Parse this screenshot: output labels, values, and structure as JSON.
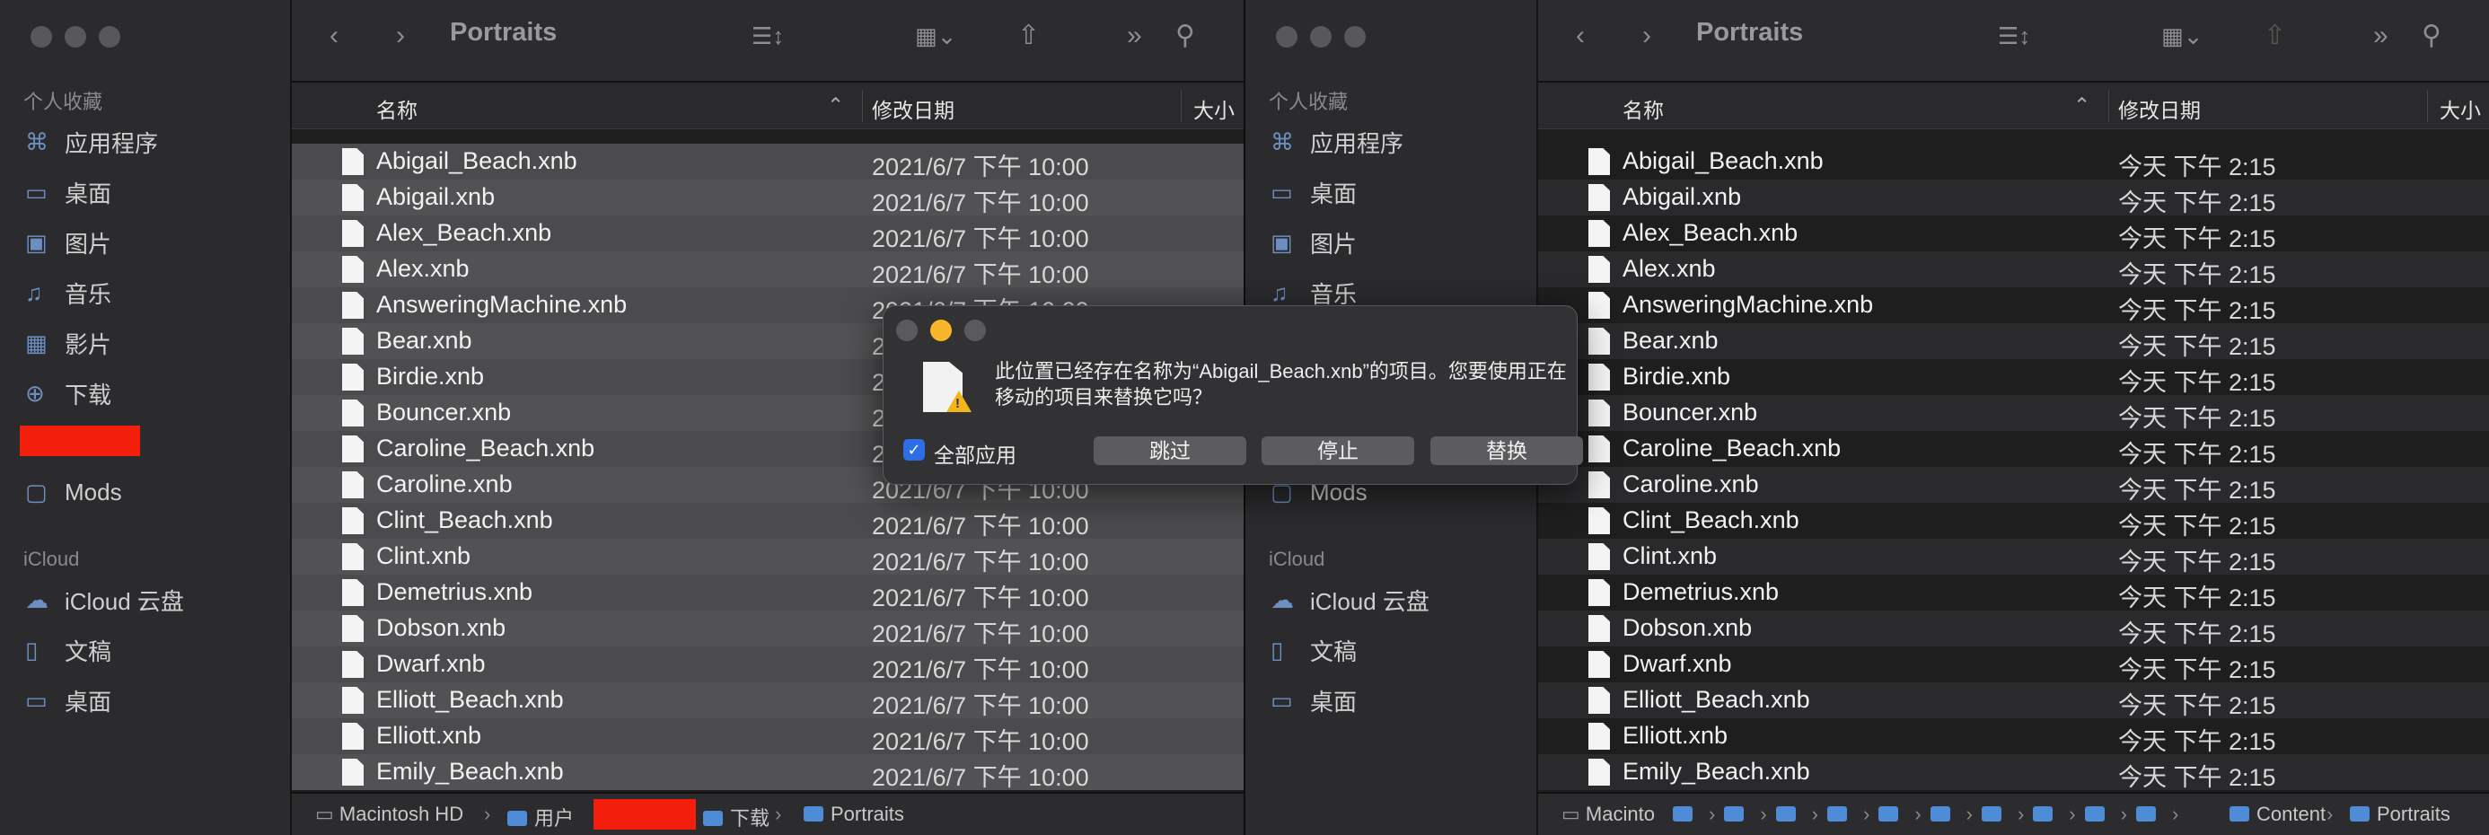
{
  "left_window": {
    "title": "Portraits",
    "sidebar": {
      "favorites_header": "个人收藏",
      "items": [
        {
          "label": "应用程序",
          "icon": "applications-icon",
          "glyph": "⌘"
        },
        {
          "label": "桌面",
          "icon": "desktop-icon",
          "glyph": "▭"
        },
        {
          "label": "图片",
          "icon": "pictures-icon",
          "glyph": "▣"
        },
        {
          "label": "音乐",
          "icon": "music-icon",
          "glyph": "♫"
        },
        {
          "label": "影片",
          "icon": "movies-icon",
          "glyph": "▦"
        },
        {
          "label": "下载",
          "icon": "downloads-icon",
          "glyph": "⊕"
        },
        {
          "label": "Mods",
          "icon": "folder-icon",
          "glyph": "▢"
        }
      ],
      "icloud_header": "iCloud",
      "icloud_items": [
        {
          "label": "iCloud 云盘",
          "icon": "icloud-drive-icon",
          "glyph": "☁"
        },
        {
          "label": "文稿",
          "icon": "documents-icon",
          "glyph": "▯"
        },
        {
          "label": "桌面",
          "icon": "desktop-icon",
          "glyph": "▭"
        }
      ]
    },
    "columns": {
      "name": "名称",
      "date": "修改日期",
      "size": "大小"
    },
    "files": [
      {
        "name": "Abigail_Beach.xnb",
        "date": "2021/6/7 下午 10:00"
      },
      {
        "name": "Abigail.xnb",
        "date": "2021/6/7 下午 10:00"
      },
      {
        "name": "Alex_Beach.xnb",
        "date": "2021/6/7 下午 10:00"
      },
      {
        "name": "Alex.xnb",
        "date": "2021/6/7 下午 10:00"
      },
      {
        "name": "AnsweringMachine.xnb",
        "date": "2021/6/7 下午 10:00"
      },
      {
        "name": "Bear.xnb",
        "date": "2021/6/7 下午 10:00"
      },
      {
        "name": "Birdie.xnb",
        "date": "2021/6/7 下午 10:00"
      },
      {
        "name": "Bouncer.xnb",
        "date": "2021/6/7 下午 10:00"
      },
      {
        "name": "Caroline_Beach.xnb",
        "date": "2021/6/7 下午 10:00"
      },
      {
        "name": "Caroline.xnb",
        "date": "2021/6/7 下午 10:00"
      },
      {
        "name": "Clint_Beach.xnb",
        "date": "2021/6/7 下午 10:00"
      },
      {
        "name": "Clint.xnb",
        "date": "2021/6/7 下午 10:00"
      },
      {
        "name": "Demetrius.xnb",
        "date": "2021/6/7 下午 10:00"
      },
      {
        "name": "Dobson.xnb",
        "date": "2021/6/7 下午 10:00"
      },
      {
        "name": "Dwarf.xnb",
        "date": "2021/6/7 下午 10:00"
      },
      {
        "name": "Elliott_Beach.xnb",
        "date": "2021/6/7 下午 10:00"
      },
      {
        "name": "Elliott.xnb",
        "date": "2021/6/7 下午 10:00"
      },
      {
        "name": "Emily_Beach.xnb",
        "date": "2021/6/7 下午 10:00"
      }
    ],
    "path": {
      "disk": "Macintosh HD",
      "users": "用户",
      "downloads": "下载",
      "current": "Portraits"
    }
  },
  "right_window": {
    "title": "Portraits",
    "columns": {
      "name": "名称",
      "date": "修改日期",
      "size": "大小"
    },
    "files": [
      {
        "name": "Abigail_Beach.xnb",
        "date": "今天 下午 2:15"
      },
      {
        "name": "Abigail.xnb",
        "date": "今天 下午 2:15"
      },
      {
        "name": "Alex_Beach.xnb",
        "date": "今天 下午 2:15"
      },
      {
        "name": "Alex.xnb",
        "date": "今天 下午 2:15"
      },
      {
        "name": "AnsweringMachine.xnb",
        "date": "今天 下午 2:15"
      },
      {
        "name": "Bear.xnb",
        "date": "今天 下午 2:15"
      },
      {
        "name": "Birdie.xnb",
        "date": "今天 下午 2:15"
      },
      {
        "name": "Bouncer.xnb",
        "date": "今天 下午 2:15"
      },
      {
        "name": "Caroline_Beach.xnb",
        "date": "今天 下午 2:15"
      },
      {
        "name": "Caroline.xnb",
        "date": "今天 下午 2:15"
      },
      {
        "name": "Clint_Beach.xnb",
        "date": "今天 下午 2:15"
      },
      {
        "name": "Clint.xnb",
        "date": "今天 下午 2:15"
      },
      {
        "name": "Demetrius.xnb",
        "date": "今天 下午 2:15"
      },
      {
        "name": "Dobson.xnb",
        "date": "今天 下午 2:15"
      },
      {
        "name": "Dwarf.xnb",
        "date": "今天 下午 2:15"
      },
      {
        "name": "Elliott_Beach.xnb",
        "date": "今天 下午 2:15"
      },
      {
        "name": "Elliott.xnb",
        "date": "今天 下午 2:15"
      },
      {
        "name": "Emily_Beach.xnb",
        "date": "今天 下午 2:15"
      }
    ],
    "path": {
      "disk": "Macinto",
      "content": "Content",
      "current": "Portraits"
    }
  },
  "dialog": {
    "message": "此位置已经存在名称为“Abigail_Beach.xnb”的项目。您要使用正在移动的项目来替换它吗？",
    "apply_all": "全部应用",
    "skip": "跳过",
    "stop": "停止",
    "replace": "替换"
  },
  "colors": {
    "accent": "#2d6de5",
    "folder": "#4f8cd8",
    "redaction": "#f41e0c",
    "warning": "#f2b619"
  }
}
